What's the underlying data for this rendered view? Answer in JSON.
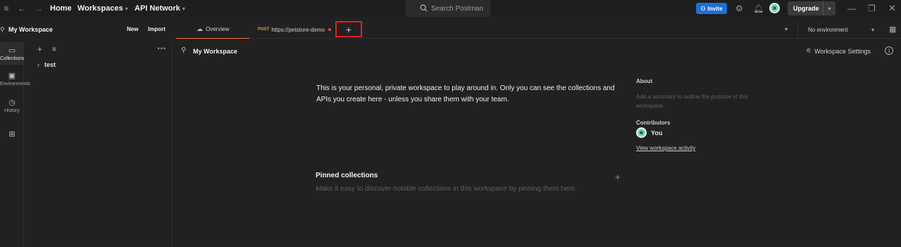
{
  "titlebar": {
    "nav": {
      "home": "Home",
      "workspaces": "Workspaces",
      "api_network": "API Network"
    },
    "search_placeholder": "Search Postman",
    "invite_label": "Invite",
    "upgrade_label": "Upgrade"
  },
  "workspace": {
    "name": "My Workspace",
    "new_label": "New",
    "import_label": "Import"
  },
  "sidebar": {
    "items": [
      {
        "label": "Collections",
        "icon": "collections-icon",
        "active": true
      },
      {
        "label": "Environments",
        "icon": "environments-icon",
        "active": false
      },
      {
        "label": "History",
        "icon": "history-icon",
        "active": false
      },
      {
        "label": "",
        "icon": "configure-icon",
        "active": false
      }
    ]
  },
  "collections": {
    "items": [
      {
        "name": "test"
      }
    ]
  },
  "tabs": [
    {
      "label": "Overview",
      "active": true
    },
    {
      "method": "POST",
      "label": "https://petstore-demo",
      "unsaved": true
    }
  ],
  "environment": {
    "selected": "No environment"
  },
  "overview": {
    "title": "My Workspace",
    "settings_label": "Workspace Settings",
    "description": "This is your personal, private workspace to play around in. Only you can see the collections and APIs you create here - unless you share them with your team.",
    "about": {
      "heading": "About",
      "placeholder": "Add a summary to outline the purpose of this workspace."
    },
    "contributors": {
      "heading": "Contributors",
      "user": "You"
    },
    "activity_link": "View workspace activity",
    "pinned": {
      "heading": "Pinned collections",
      "text": "Make it easy to discover notable collections in this workspace by pinning them here."
    }
  },
  "colors": {
    "accent": "#ff6c37",
    "invite": "#1e6fd6",
    "highlight_box": "#e02020"
  }
}
